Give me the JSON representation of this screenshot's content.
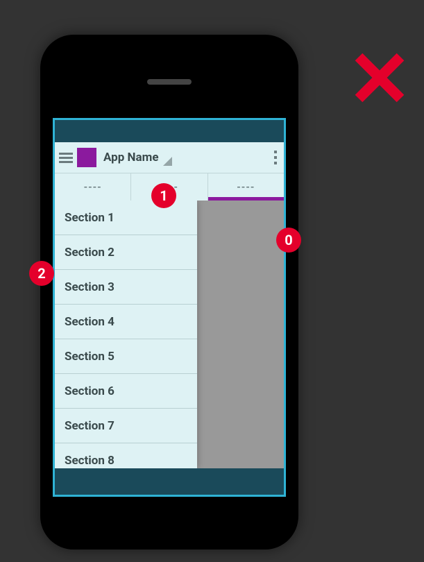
{
  "callouts": {
    "c0": "0",
    "c1": "1",
    "c2": "2"
  },
  "action_bar": {
    "app_name": "App Name"
  },
  "tabs": {
    "t1": "----",
    "t2": "----",
    "t3": "----"
  },
  "drawer": {
    "items": [
      "Section 1",
      "Section 2",
      "Section 3",
      "Section 4",
      "Section 5",
      "Section 6",
      "Section 7",
      "Section 8"
    ]
  }
}
